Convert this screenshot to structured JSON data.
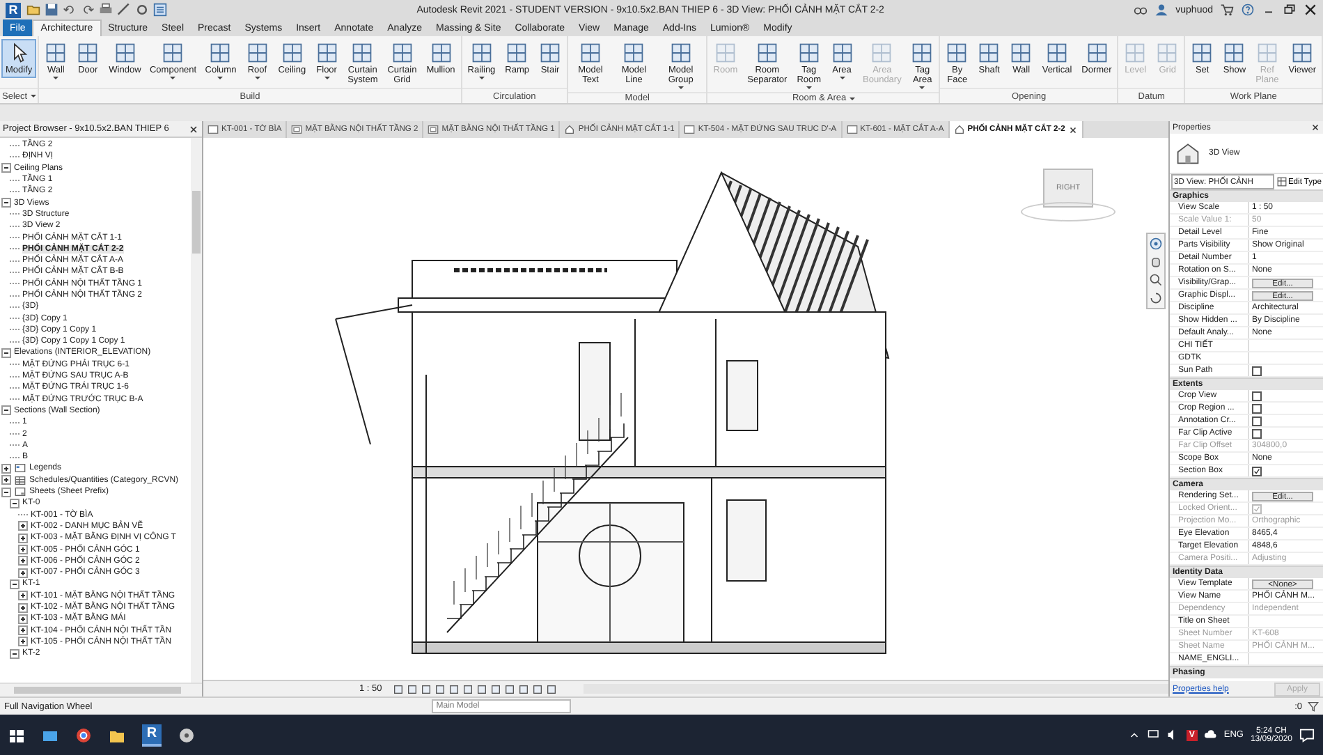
{
  "title_bar": {
    "app_letter": "R",
    "title": "Autodesk Revit 2021 - STUDENT VERSION - 9x10.5x2.BAN THIEP 6 - 3D View: PHỐI CẢNH MẶT CẮT 2-2",
    "user": "vuphuod"
  },
  "ribbon_tabs": [
    {
      "label": "File",
      "kind": "file",
      "selected": false
    },
    {
      "label": "Architecture",
      "kind": "tab",
      "selected": true
    },
    {
      "label": "Structure",
      "kind": "tab",
      "selected": false
    },
    {
      "label": "Steel",
      "kind": "tab",
      "selected": false
    },
    {
      "label": "Precast",
      "kind": "tab",
      "selected": false
    },
    {
      "label": "Systems",
      "kind": "tab",
      "selected": false
    },
    {
      "label": "Insert",
      "kind": "tab",
      "selected": false
    },
    {
      "label": "Annotate",
      "kind": "tab",
      "selected": false
    },
    {
      "label": "Analyze",
      "kind": "tab",
      "selected": false
    },
    {
      "label": "Massing & Site",
      "kind": "tab",
      "selected": false
    },
    {
      "label": "Collaborate",
      "kind": "tab",
      "selected": false
    },
    {
      "label": "View",
      "kind": "tab",
      "selected": false
    },
    {
      "label": "Manage",
      "kind": "tab",
      "selected": false
    },
    {
      "label": "Add-Ins",
      "kind": "tab",
      "selected": false
    },
    {
      "label": "Lumion®",
      "kind": "tab",
      "selected": false
    },
    {
      "label": "Modify",
      "kind": "tab",
      "selected": false
    }
  ],
  "select_panel": {
    "tool": "Modify",
    "selected": true,
    "label": "Select",
    "menu": true
  },
  "ribbon_panels": [
    {
      "label": "Build",
      "menu": false,
      "tools": [
        {
          "label": "Wall",
          "dropdown": true,
          "disabled": false
        },
        {
          "label": "Door",
          "dropdown": false,
          "disabled": false
        },
        {
          "label": "Window",
          "dropdown": false,
          "disabled": false
        },
        {
          "label": "Component",
          "dropdown": true,
          "disabled": false
        },
        {
          "label": "Column",
          "dropdown": true,
          "disabled": false
        },
        {
          "label": "Roof",
          "dropdown": true,
          "disabled": false
        },
        {
          "label": "Ceiling",
          "dropdown": false,
          "disabled": false
        },
        {
          "label": "Floor",
          "dropdown": true,
          "disabled": false
        },
        {
          "label": "Curtain System",
          "dropdown": false,
          "disabled": false
        },
        {
          "label": "Curtain Grid",
          "dropdown": false,
          "disabled": false
        },
        {
          "label": "Mullion",
          "dropdown": false,
          "disabled": false
        }
      ]
    },
    {
      "label": "Circulation",
      "menu": false,
      "tools": [
        {
          "label": "Railing",
          "dropdown": true,
          "disabled": false
        },
        {
          "label": "Ramp",
          "dropdown": false,
          "disabled": false
        },
        {
          "label": "Stair",
          "dropdown": false,
          "disabled": false
        }
      ]
    },
    {
      "label": "Model",
      "menu": false,
      "tools": [
        {
          "label": "Model Text",
          "dropdown": false,
          "disabled": false
        },
        {
          "label": "Model Line",
          "dropdown": false,
          "disabled": false
        },
        {
          "label": "Model Group",
          "dropdown": true,
          "disabled": false
        }
      ]
    },
    {
      "label": "Room & Area",
      "menu": true,
      "tools": [
        {
          "label": "Room",
          "dropdown": false,
          "disabled": true
        },
        {
          "label": "Room Separator",
          "dropdown": false,
          "disabled": false
        },
        {
          "label": "Tag Room",
          "dropdown": true,
          "disabled": false
        },
        {
          "label": "Area",
          "dropdown": true,
          "disabled": false
        },
        {
          "label": "Area Boundary",
          "dropdown": false,
          "disabled": true
        },
        {
          "label": "Tag Area",
          "dropdown": true,
          "disabled": false
        }
      ]
    },
    {
      "label": "Opening",
      "menu": false,
      "tools": [
        {
          "label": "By Face",
          "dropdown": false,
          "disabled": false
        },
        {
          "label": "Shaft",
          "dropdown": false,
          "disabled": false
        },
        {
          "label": "Wall",
          "dropdown": false,
          "disabled": false
        },
        {
          "label": "Vertical",
          "dropdown": false,
          "disabled": false
        },
        {
          "label": "Dormer",
          "dropdown": false,
          "disabled": false
        }
      ]
    },
    {
      "label": "Datum",
      "menu": false,
      "tools": [
        {
          "label": "Level",
          "dropdown": false,
          "disabled": true
        },
        {
          "label": "Grid",
          "dropdown": false,
          "disabled": true
        }
      ]
    },
    {
      "label": "Work Plane",
      "menu": false,
      "tools": [
        {
          "label": "Set",
          "dropdown": false,
          "disabled": false
        },
        {
          "label": "Show",
          "dropdown": false,
          "disabled": false
        },
        {
          "label": "Ref Plane",
          "dropdown": false,
          "disabled": true
        },
        {
          "label": "Viewer",
          "dropdown": false,
          "disabled": false
        }
      ]
    }
  ],
  "project_browser": {
    "title": "Project Browser - 9x10.5x2.BAN THIEP 6",
    "tree": [
      {
        "children": [
          {
            "children": [
              {
                "label": "TẦNG 2"
              },
              {
                "label": "ĐỊNH VỊ"
              }
            ]
          },
          {
            "label": "Ceiling Plans",
            "expanded": true,
            "children": [
              {
                "label": "TẦNG 1"
              },
              {
                "label": "TẦNG 2"
              }
            ]
          },
          {
            "label": "3D Views",
            "expanded": true,
            "children": [
              {
                "label": "3D Structure",
                "selected": false
              },
              {
                "label": "3D View 2",
                "selected": false
              },
              {
                "label": "PHỐI CẢNH MẶT CẮT 1-1",
                "selected": false
              },
              {
                "label": "PHỐI CẢNH MẶT CẮT 2-2",
                "selected": true
              },
              {
                "label": "PHỐI CẢNH MẶT CẮT A-A",
                "selected": false
              },
              {
                "label": "PHỐI CẢNH MẶT CẮT B-B",
                "selected": false
              },
              {
                "label": "PHỐI CẢNH NỘI THẤT TẦNG 1",
                "selected": false
              },
              {
                "label": "PHỐI CẢNH NỘI THẤT TẦNG  2",
                "selected": false
              },
              {
                "label": "{3D}",
                "selected": false
              },
              {
                "label": "{3D} Copy 1",
                "selected": false
              },
              {
                "label": "{3D} Copy 1 Copy 1",
                "selected": false
              },
              {
                "label": "{3D} Copy 1 Copy 1 Copy 1",
                "selected": false
              }
            ]
          },
          {
            "label": "Elevations (INTERIOR_ELEVATION)",
            "expanded": true,
            "children": [
              {
                "label": "MẶT ĐỨNG PHẢI TRỤC 6-1"
              },
              {
                "label": "MẶT ĐỨNG SAU TRỤC A-B"
              },
              {
                "label": "MẶT ĐỨNG TRÁI TRỤC 1-6"
              },
              {
                "label": "MẶT ĐỨNG TRƯỚC TRỤC B-A"
              }
            ]
          },
          {
            "label": "Sections (Wall Section)",
            "expanded": true,
            "children": [
              {
                "label": "1"
              },
              {
                "label": "2"
              },
              {
                "label": "A"
              },
              {
                "label": "B"
              }
            ]
          }
        ]
      },
      {
        "label": "Legends",
        "kind": "legend",
        "expanded": false
      },
      {
        "label": "Schedules/Quantities (Category_RCVN)",
        "kind": "schedule",
        "expanded": false
      },
      {
        "label": "Sheets (Sheet Prefix)",
        "kind": "sheet",
        "expanded": true,
        "children": [
          {
            "label": "KT-0",
            "expanded": true,
            "children": [
              {
                "label": "KT-001 - TỜ BÌA"
              },
              {
                "label": "KT-002 - DANH MỤC BẢN VẼ",
                "expanded": false
              },
              {
                "label": "KT-003 - MẶT BẰNG ĐỊNH VỊ CÔNG T",
                "expanded": false
              },
              {
                "label": "KT-005 - PHỐI CẢNH GÓC 1",
                "expanded": false
              },
              {
                "label": "KT-006 - PHỐI CẢNH GÓC 2",
                "expanded": false
              },
              {
                "label": "KT-007 - PHỐI CẢNH GÓC 3",
                "expanded": false
              }
            ]
          },
          {
            "label": "KT-1",
            "expanded": true,
            "children": [
              {
                "label": "KT-101 - MẶT BẰNG NỘI THẤT TẦNG",
                "expanded": false
              },
              {
                "label": "KT-102 - MẶT BẰNG NỘI THẤT TẦNG",
                "expanded": false
              },
              {
                "label": "KT-103 - MẶT BẰNG MÁI",
                "expanded": false
              },
              {
                "label": "KT-104 - PHỐI CẢNH NỘI THẤT TẦN",
                "expanded": false
              },
              {
                "label": "KT-105 - PHỐI CẢNH NỘI THẤT TẦN",
                "expanded": false
              }
            ]
          },
          {
            "label": "KT-2",
            "expanded": true
          }
        ]
      }
    ]
  },
  "view_tabs": [
    {
      "label": "KT-001 - TỜ BÌA",
      "kind": "sheet",
      "selected": false
    },
    {
      "label": "MẶT BẰNG NỘI THẤT TẦNG 2",
      "kind": "plan",
      "selected": false
    },
    {
      "label": "MẶT BẰNG NỘI THẤT TẦNG 1",
      "kind": "plan",
      "selected": false
    },
    {
      "label": "PHỐI CẢNH MẶT CẮT 1-1",
      "kind": "camera",
      "selected": false
    },
    {
      "label": "KT-504 - MẶT ĐỨNG SAU TRUC D'-A",
      "kind": "sheet",
      "selected": false
    },
    {
      "label": "KT-601 - MẶT CẮT A-A",
      "kind": "sheet",
      "selected": false
    },
    {
      "label": "PHỐI CẢNH MẶT CẮT 2-2",
      "kind": "camera",
      "selected": true
    }
  ],
  "view": {
    "view_cube_label": "RIGHT",
    "scale": "1 : 50"
  },
  "properties": {
    "title": "Properties",
    "type_name": "3D View",
    "selector": "3D View: PHỐI CẢNH",
    "edit_type": "Edit Type",
    "sections": [
      {
        "title": "Graphics",
        "rows": [
          {
            "name": "View Scale",
            "value": "1 : 50",
            "kind": "text",
            "disabled": false
          },
          {
            "name": "Scale Value    1:",
            "value": "50",
            "kind": "text",
            "disabled": true
          },
          {
            "name": "Detail Level",
            "value": "Fine",
            "kind": "text",
            "disabled": false
          },
          {
            "name": "Parts Visibility",
            "value": "Show Original",
            "kind": "text",
            "disabled": false
          },
          {
            "name": "Detail Number",
            "value": "1",
            "kind": "text",
            "disabled": false
          },
          {
            "name": "Rotation on S...",
            "value": "None",
            "kind": "text",
            "disabled": false
          },
          {
            "name": "Visibility/Grap...",
            "value": "Edit...",
            "kind": "button",
            "disabled": false
          },
          {
            "name": "Graphic Displ...",
            "value": "Edit...",
            "kind": "button",
            "disabled": false
          },
          {
            "name": "Discipline",
            "value": "Architectural",
            "kind": "text",
            "disabled": false
          },
          {
            "name": "Show Hidden ...",
            "value": "By Discipline",
            "kind": "text",
            "disabled": false
          },
          {
            "name": "Default Analy...",
            "value": "None",
            "kind": "text",
            "disabled": false
          },
          {
            "name": "CHI TIẾT",
            "kind": "text",
            "disabled": false
          },
          {
            "name": "GDTK",
            "kind": "text",
            "disabled": false
          },
          {
            "name": "Sun Path",
            "kind": "checkbox",
            "checked": false,
            "disabled": false
          }
        ]
      },
      {
        "title": "Extents",
        "rows": [
          {
            "name": "Crop View",
            "kind": "checkbox",
            "checked": false,
            "disabled": false
          },
          {
            "name": "Crop Region ...",
            "kind": "checkbox",
            "checked": false,
            "disabled": false
          },
          {
            "name": "Annotation Cr...",
            "kind": "checkbox",
            "checked": false,
            "disabled": false
          },
          {
            "name": "Far Clip Active",
            "kind": "checkbox",
            "checked": false,
            "disabled": false
          },
          {
            "name": "Far Clip Offset",
            "value": "304800,0",
            "kind": "text",
            "disabled": true
          },
          {
            "name": "Scope Box",
            "value": "None",
            "kind": "text",
            "disabled": false
          },
          {
            "name": "Section Box",
            "kind": "checkbox",
            "checked": true,
            "disabled": false
          }
        ]
      },
      {
        "title": "Camera",
        "rows": [
          {
            "name": "Rendering Set...",
            "value": "Edit...",
            "kind": "button",
            "disabled": false
          },
          {
            "name": "Locked Orient...",
            "kind": "checkbox",
            "checked": true,
            "disabled": true
          },
          {
            "name": "Projection Mo...",
            "value": "Orthographic",
            "kind": "text",
            "disabled": true
          },
          {
            "name": "Eye Elevation",
            "value": "8465,4",
            "kind": "text",
            "disabled": false
          },
          {
            "name": "Target Elevation",
            "value": "4848,6",
            "kind": "text",
            "disabled": false
          },
          {
            "name": "Camera Positi...",
            "value": "Adjusting",
            "kind": "text",
            "disabled": true
          }
        ]
      },
      {
        "title": "Identity Data",
        "rows": [
          {
            "name": "View Template",
            "value": "<None>",
            "kind": "button",
            "disabled": false
          },
          {
            "name": "View Name",
            "value": "PHỐI CẢNH M...",
            "kind": "text",
            "disabled": false
          },
          {
            "name": "Dependency",
            "value": "Independent",
            "kind": "text",
            "disabled": true
          },
          {
            "name": "Title on Sheet",
            "kind": "text",
            "disabled": false
          },
          {
            "name": "Sheet Number",
            "value": "KT-608",
            "kind": "text",
            "disabled": true
          },
          {
            "name": "Sheet Name",
            "value": "PHỐI CẢNH M...",
            "kind": "text",
            "disabled": true
          },
          {
            "name": "NAME_ENGLI...",
            "kind": "text",
            "disabled": false
          }
        ]
      },
      {
        "title": "Phasing"
      }
    ],
    "help_link": "Properties help",
    "apply": {
      "label": "Apply",
      "disabled": true
    }
  },
  "status_bar": {
    "message": "Full Navigation Wheel",
    "model": "Main Model",
    "filter_count": ":0"
  },
  "taskbar": {
    "app_letter": "R",
    "tray_letter": "V",
    "language": "ENG",
    "time": "5:24 CH",
    "date": "13/09/2020"
  }
}
